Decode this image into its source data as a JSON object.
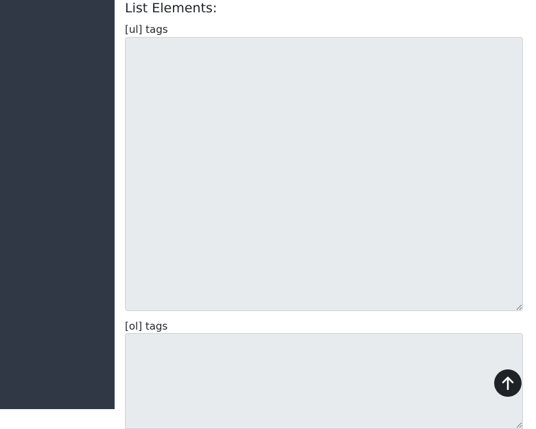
{
  "main": {
    "section_heading": "List Elements:",
    "ul_field": {
      "label": "[ul] tags",
      "value": ""
    },
    "ol_field": {
      "label": "[ol] tags",
      "value": ""
    }
  },
  "scroll_top_button": {
    "icon": "arrow-up-icon"
  },
  "colors": {
    "sidebar": "#313845",
    "textarea_bg": "#e8ebee",
    "scroll_button": "#1f2327"
  }
}
